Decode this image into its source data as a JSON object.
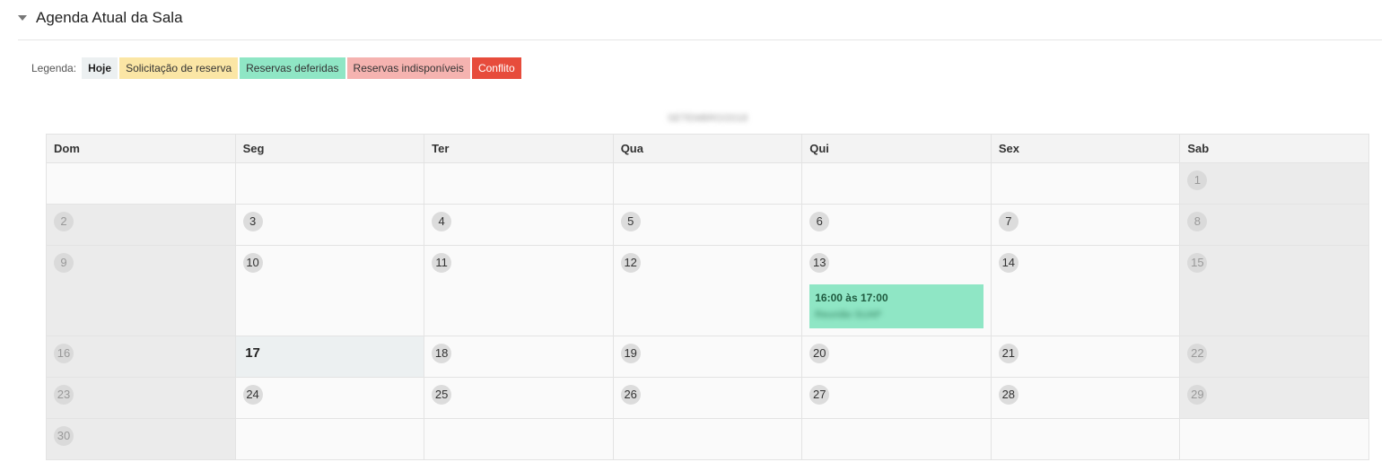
{
  "section": {
    "title": "Agenda Atual da Sala"
  },
  "legend": {
    "label": "Legenda:",
    "today": "Hoje",
    "request": "Solicitação de reserva",
    "approved": "Reservas deferidas",
    "unavailable": "Reservas indisponíveis",
    "conflict": "Conflito"
  },
  "calendar": {
    "month_title": "SETEMBRO/2018",
    "weekdays": [
      "Dom",
      "Seg",
      "Ter",
      "Qua",
      "Qui",
      "Sex",
      "Sab"
    ],
    "days": [
      "1",
      "2",
      "3",
      "4",
      "5",
      "6",
      "7",
      "8",
      "9",
      "10",
      "11",
      "12",
      "13",
      "14",
      "15",
      "16",
      "17",
      "18",
      "19",
      "20",
      "21",
      "22",
      "23",
      "24",
      "25",
      "26",
      "27",
      "28",
      "29",
      "30"
    ],
    "event": {
      "time": "16:00 às 17:00",
      "title": "Reunião SUAP"
    }
  },
  "colors": {
    "today": "#ecf0f1",
    "request": "#fbe6a5",
    "approved": "#8fe6c5",
    "unavailable": "#f5b3b0",
    "conflict": "#e74c3c"
  }
}
